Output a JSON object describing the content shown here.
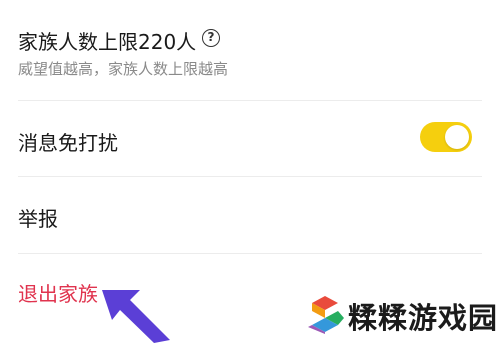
{
  "settings": {
    "limit": {
      "title": "家族人数上限220人",
      "subtitle": "威望值越高，家族人数上限越高",
      "help_icon": "question-circle-icon"
    },
    "do_not_disturb": {
      "label": "消息免打扰",
      "enabled": true,
      "toggle_color": "#F5CF0E"
    },
    "report": {
      "label": "举报"
    },
    "exit_family": {
      "label": "退出家族",
      "color": "#E0334E"
    }
  },
  "annotation": {
    "arrow_color": "#5B3FD6",
    "arrow_icon": "arrow-up-left-icon"
  },
  "watermark": {
    "text": "糅糅游戏园",
    "logo_icon": "colorful-s-logo-icon"
  }
}
